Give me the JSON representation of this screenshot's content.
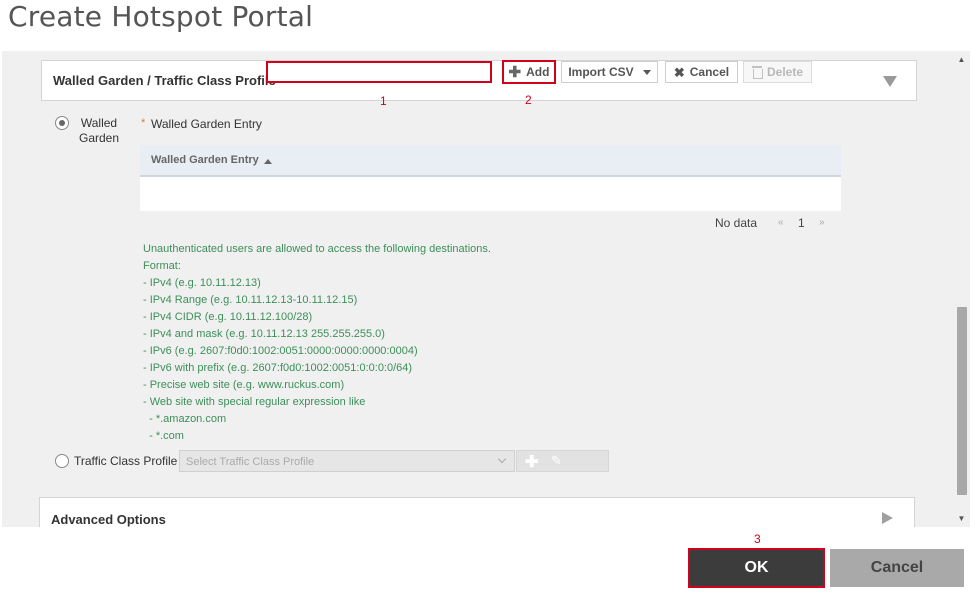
{
  "page": {
    "title": "Create Hotspot Portal"
  },
  "walled_garden_section": {
    "title": "Walled Garden / Traffic Class Profile",
    "expanded": true,
    "radio_walled_garden": {
      "label_line1": "Walled",
      "label_line2": "Garden",
      "selected": true
    },
    "entry_field": {
      "required_marker": "*",
      "label": "Walled Garden Entry",
      "value": "",
      "placeholder": ""
    },
    "toolbar": {
      "add_label": "Add",
      "import_label": "Import CSV",
      "cancel_label": "Cancel",
      "delete_label": "Delete"
    },
    "table": {
      "columns": [
        "Walled Garden Entry"
      ],
      "sort": "ascending",
      "rows": []
    },
    "pager": {
      "status": "No data",
      "prev": "«",
      "page": "1",
      "next": "»"
    },
    "help_lines": [
      "Unauthenticated users are allowed to access the following destinations.",
      "Format:",
      "- IPv4 (e.g. 10.11.12.13)",
      "- IPv4 Range (e.g. 10.11.12.13-10.11.12.15)",
      "- IPv4 CIDR (e.g. 10.11.12.100/28)",
      "- IPv4 and mask (e.g. 10.11.12.13 255.255.255.0)",
      "- IPv6 (e.g. 2607:f0d0:1002:0051:0000:0000:0000:0004)",
      "- IPv6 with prefix (e.g. 2607:f0d0:1002:0051:0:0:0:0/64)",
      "- Precise web site (e.g. www.ruckus.com)",
      "- Web site with special regular expression like",
      "  - *.amazon.com",
      "  - *.com"
    ],
    "radio_traffic_class": {
      "label": "Traffic Class Profile",
      "selected": false
    },
    "traffic_class_select": {
      "placeholder": "Select Traffic Class Profile",
      "disabled": true
    }
  },
  "advanced_section": {
    "title": "Advanced Options",
    "expanded": false
  },
  "footer": {
    "ok_label": "OK",
    "cancel_label": "Cancel"
  },
  "annotations": {
    "one": "1",
    "two": "2",
    "three": "3"
  },
  "colors": {
    "highlight": "#d0021b",
    "help_text": "#3d8f5a",
    "ok_bg": "#3c3c3c",
    "cancel_bg": "#a9a9a9"
  },
  "icons": {
    "add": "plus-icon",
    "import_caret": "chevron-down-icon",
    "cancel": "close-icon",
    "delete": "trash-icon",
    "sort": "sort-up-icon",
    "section_collapse": "triangle-down-icon",
    "section_expand": "triangle-right-icon",
    "tcp_add": "plus-icon",
    "tcp_edit": "pencil-icon"
  }
}
